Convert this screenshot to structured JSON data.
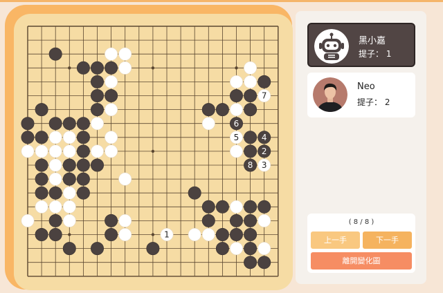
{
  "board": {
    "size": 19,
    "black_stones": [
      [
        2,
        2
      ],
      [
        4,
        3
      ],
      [
        5,
        3
      ],
      [
        6,
        3
      ],
      [
        5,
        4
      ],
      [
        5,
        5
      ],
      [
        6,
        5
      ],
      [
        1,
        6
      ],
      [
        5,
        6
      ],
      [
        0,
        7
      ],
      [
        2,
        7
      ],
      [
        3,
        7
      ],
      [
        4,
        7
      ],
      [
        0,
        8
      ],
      [
        1,
        8
      ],
      [
        4,
        8
      ],
      [
        4,
        9
      ],
      [
        1,
        10
      ],
      [
        3,
        10
      ],
      [
        4,
        10
      ],
      [
        5,
        10
      ],
      [
        1,
        11
      ],
      [
        3,
        11
      ],
      [
        4,
        11
      ],
      [
        1,
        12
      ],
      [
        2,
        12
      ],
      [
        4,
        12
      ],
      [
        12,
        12
      ],
      [
        13,
        13
      ],
      [
        14,
        13
      ],
      [
        16,
        13
      ],
      [
        17,
        13
      ],
      [
        2,
        14
      ],
      [
        6,
        14
      ],
      [
        13,
        14
      ],
      [
        15,
        14
      ],
      [
        16,
        14
      ],
      [
        1,
        15
      ],
      [
        2,
        15
      ],
      [
        6,
        15
      ],
      [
        14,
        15
      ],
      [
        16,
        15
      ],
      [
        3,
        16
      ],
      [
        5,
        16
      ],
      [
        9,
        16
      ],
      [
        14,
        16
      ],
      [
        16,
        16
      ],
      [
        17,
        17
      ],
      [
        16,
        17
      ],
      [
        16,
        6
      ],
      [
        15,
        5
      ],
      [
        16,
        5
      ],
      [
        17,
        5
      ],
      [
        17,
        4
      ],
      [
        14,
        6
      ],
      [
        13,
        6
      ],
      [
        15,
        7
      ],
      [
        16,
        8
      ],
      [
        16,
        9
      ],
      [
        17,
        8
      ],
      [
        15,
        15
      ]
    ],
    "white_stones": [
      [
        6,
        2
      ],
      [
        7,
        2
      ],
      [
        6,
        3
      ],
      [
        7,
        3
      ],
      [
        16,
        3
      ],
      [
        15,
        4
      ],
      [
        16,
        4
      ],
      [
        17,
        4
      ],
      [
        16,
        5
      ],
      [
        6,
        4
      ],
      [
        6,
        5
      ],
      [
        6,
        6
      ],
      [
        13,
        6
      ],
      [
        15,
        6
      ],
      [
        5,
        7
      ],
      [
        13,
        7
      ],
      [
        2,
        8
      ],
      [
        3,
        8
      ],
      [
        1,
        9
      ],
      [
        2,
        9
      ],
      [
        3,
        9
      ],
      [
        5,
        9
      ],
      [
        6,
        8
      ],
      [
        6,
        9
      ],
      [
        2,
        10
      ],
      [
        2,
        11
      ],
      [
        0,
        9
      ],
      [
        3,
        12
      ],
      [
        7,
        11
      ],
      [
        15,
        9
      ],
      [
        16,
        9
      ],
      [
        17,
        10
      ],
      [
        1,
        13
      ],
      [
        3,
        13
      ],
      [
        3,
        14
      ],
      [
        0,
        14
      ],
      [
        2,
        13
      ],
      [
        6,
        14
      ],
      [
        7,
        14
      ],
      [
        7,
        15
      ],
      [
        1,
        15
      ],
      [
        13,
        15
      ],
      [
        12,
        15
      ],
      [
        14,
        15
      ],
      [
        15,
        13
      ],
      [
        16,
        13
      ],
      [
        17,
        13
      ],
      [
        17,
        14
      ],
      [
        15,
        16
      ],
      [
        16,
        16
      ],
      [
        17,
        16
      ],
      [
        15,
        15
      ],
      [
        17,
        17
      ],
      [
        3,
        11
      ]
    ],
    "labels": [
      {
        "col": 17,
        "row": 5,
        "text": "7",
        "color": "white"
      },
      {
        "col": 15,
        "row": 7,
        "text": "6",
        "color": "black"
      },
      {
        "col": 15,
        "row": 8,
        "text": "5",
        "color": "white"
      },
      {
        "col": 17,
        "row": 8,
        "text": "4",
        "color": "black"
      },
      {
        "col": 17,
        "row": 9,
        "text": "2",
        "color": "black"
      },
      {
        "col": 16,
        "row": 10,
        "text": "8",
        "color": "black"
      },
      {
        "col": 17,
        "row": 10,
        "text": "3",
        "color": "white"
      },
      {
        "col": 10,
        "row": 15,
        "text": "1",
        "color": "white"
      }
    ]
  },
  "players": {
    "black": {
      "name": "黑小嘉",
      "captures_label": "提子：",
      "captures": "1",
      "avatar": "robot-icon"
    },
    "white": {
      "name": "Neo",
      "captures_label": "提子：",
      "captures": "2",
      "avatar": "person-photo"
    }
  },
  "controls": {
    "move_count": "( 8 / 8 )",
    "prev_label": "上一手",
    "next_label": "下一手",
    "leave_label": "離開變化圖"
  },
  "colors": {
    "board": "#f6dca4",
    "frame": "#f9b665",
    "active_card": "#514544",
    "prev_button": "#f9c880",
    "next_button": "#f5b35f",
    "leave_button": "#f68d63"
  }
}
